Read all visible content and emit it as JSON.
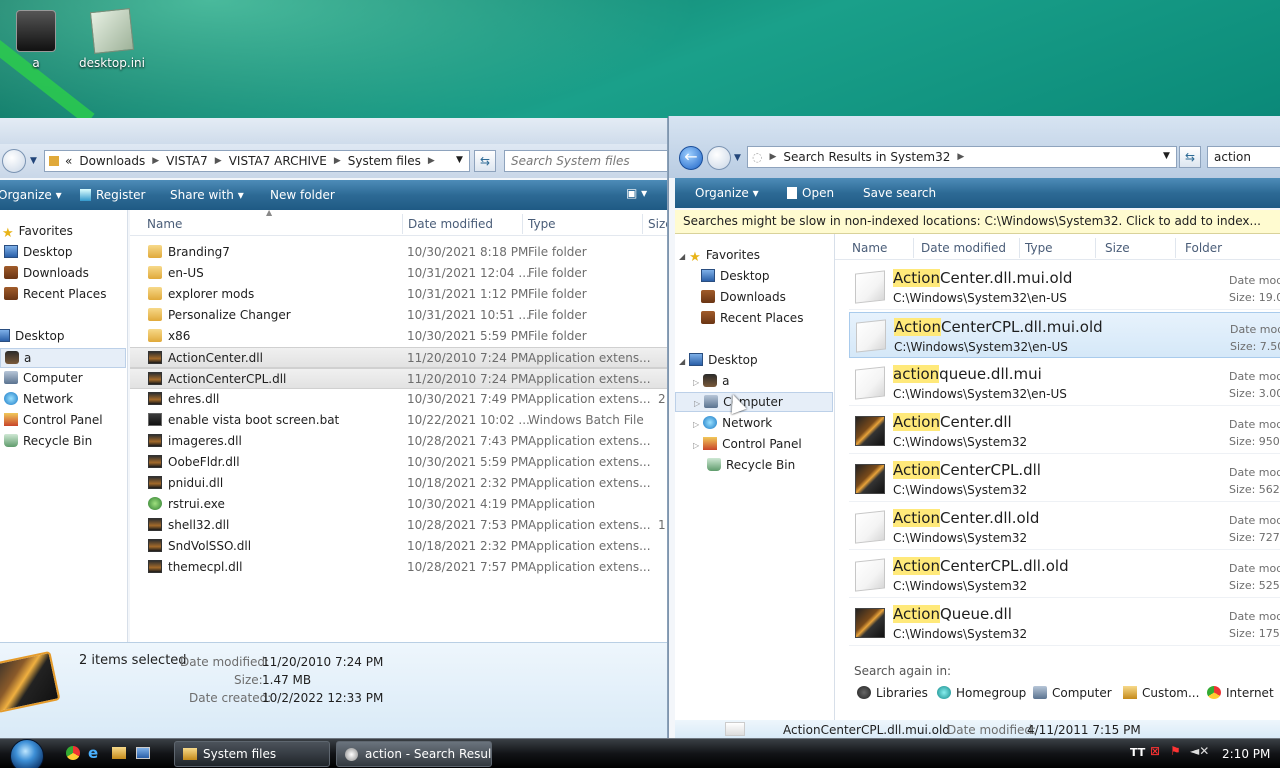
{
  "desktop": {
    "icons": [
      {
        "label": "a"
      },
      {
        "label": "desktop.ini"
      }
    ]
  },
  "win1": {
    "breadcrumb": [
      "«",
      "Downloads",
      "VISTA7",
      "VISTA7 ARCHIVE",
      "System files"
    ],
    "search_placeholder": "Search System files",
    "toolbar": {
      "organize": "Organize",
      "register": "Register",
      "share": "Share with",
      "newfolder": "New folder"
    },
    "nav": {
      "favorites": "Favorites",
      "desktop": "Desktop",
      "downloads": "Downloads",
      "recent": "Recent Places",
      "desktop2": "Desktop",
      "a": "a",
      "computer": "Computer",
      "network": "Network",
      "control": "Control Panel",
      "recycle": "Recycle Bin"
    },
    "columns": {
      "name": "Name",
      "date": "Date modified",
      "type": "Type",
      "size": "Size"
    },
    "files": [
      {
        "name": "Branding7",
        "date": "10/30/2021 8:18 PM",
        "type": "File folder",
        "icon": "folder"
      },
      {
        "name": "en-US",
        "date": "10/31/2021 12:04 ...",
        "type": "File folder",
        "icon": "folder"
      },
      {
        "name": "explorer mods",
        "date": "10/31/2021 1:12 PM",
        "type": "File folder",
        "icon": "folder"
      },
      {
        "name": "Personalize Changer",
        "date": "10/31/2021 10:51 ...",
        "type": "File folder",
        "icon": "folder"
      },
      {
        "name": "x86",
        "date": "10/30/2021 5:59 PM",
        "type": "File folder",
        "icon": "folder"
      },
      {
        "name": "ActionCenter.dll",
        "date": "11/20/2010 7:24 PM",
        "type": "Application extens...",
        "icon": "dll"
      },
      {
        "name": "ActionCenterCPL.dll",
        "date": "11/20/2010 7:24 PM",
        "type": "Application extens...",
        "icon": "dll"
      },
      {
        "name": "ehres.dll",
        "date": "10/30/2021 7:49 PM",
        "type": "Application extens...",
        "icon": "dll",
        "size": "2"
      },
      {
        "name": "enable vista boot screen.bat",
        "date": "10/22/2021 10:02 ...",
        "type": "Windows Batch File",
        "icon": "bat"
      },
      {
        "name": "imageres.dll",
        "date": "10/28/2021 7:43 PM",
        "type": "Application extens...",
        "icon": "dll"
      },
      {
        "name": "OobeFldr.dll",
        "date": "10/30/2021 5:59 PM",
        "type": "Application extens...",
        "icon": "dll"
      },
      {
        "name": "pnidui.dll",
        "date": "10/18/2021 2:32 PM",
        "type": "Application extens...",
        "icon": "dll"
      },
      {
        "name": "rstrui.exe",
        "date": "10/30/2021 4:19 PM",
        "type": "Application",
        "icon": "app"
      },
      {
        "name": "shell32.dll",
        "date": "10/28/2021 7:53 PM",
        "type": "Application extens...",
        "icon": "dll",
        "size": "1"
      },
      {
        "name": "SndVolSSO.dll",
        "date": "10/18/2021 2:32 PM",
        "type": "Application extens...",
        "icon": "dll"
      },
      {
        "name": "themecpl.dll",
        "date": "10/28/2021 7:57 PM",
        "type": "Application extens...",
        "icon": "dll"
      }
    ],
    "details": {
      "selected": "2 items selected",
      "modified_label": "Date modified:",
      "modified": "11/20/2010 7:24 PM",
      "size_label": "Size:",
      "size": "1.47 MB",
      "created_label": "Date created:",
      "created": "10/2/2022 12:33 PM"
    }
  },
  "win2": {
    "breadcrumb": "Search Results in System32",
    "search_value": "action",
    "toolbar": {
      "organize": "Organize",
      "open": "Open",
      "save": "Save search"
    },
    "infobar": "Searches might be slow in non-indexed locations: C:\\Windows\\System32. Click to add to index...",
    "nav": {
      "favorites": "Favorites",
      "desktop": "Desktop",
      "downloads": "Downloads",
      "recent": "Recent Places",
      "desktop2": "Desktop",
      "a": "a",
      "computer": "Computer",
      "network": "Network",
      "control": "Control Panel",
      "recycle": "Recycle Bin"
    },
    "columns": {
      "name": "Name",
      "date": "Date modified",
      "type": "Type",
      "size": "Size",
      "folder": "Folder"
    },
    "results": [
      {
        "hl": "Action",
        "rest": "Center.dll.mui.old",
        "path": "C:\\Windows\\System32\\en-US",
        "meta1": "Date mod",
        "meta2": "Size: 19.0",
        "thumb": "doc"
      },
      {
        "hl": "Action",
        "rest": "CenterCPL.dll.mui.old",
        "path": "C:\\Windows\\System32\\en-US",
        "meta1": "Date mod",
        "meta2": "Size: 7.50",
        "thumb": "doc"
      },
      {
        "hl": "action",
        "rest": "queue.dll.mui",
        "path": "C:\\Windows\\System32\\en-US",
        "meta1": "Date mod",
        "meta2": "Size: 3.00",
        "thumb": "doc"
      },
      {
        "hl": "Action",
        "rest": "Center.dll",
        "path": "C:\\Windows\\System32",
        "meta1": "Date mod",
        "meta2": "Size: 950 k",
        "thumb": "dllbig"
      },
      {
        "hl": "Action",
        "rest": "CenterCPL.dll",
        "path": "C:\\Windows\\System32",
        "meta1": "Date mod",
        "meta2": "Size: 562 k",
        "thumb": "dllbig"
      },
      {
        "hl": "Action",
        "rest": "Center.dll.old",
        "path": "C:\\Windows\\System32",
        "meta1": "Date mod",
        "meta2": "Size: 727 k",
        "thumb": "doc"
      },
      {
        "hl": "Action",
        "rest": "CenterCPL.dll.old",
        "path": "C:\\Windows\\System32",
        "meta1": "Date mod",
        "meta2": "Size: 525 k",
        "thumb": "doc"
      },
      {
        "hl": "Action",
        "rest": "Queue.dll",
        "path": "C:\\Windows\\System32",
        "meta1": "Date mod",
        "meta2": "Size: 175 k",
        "thumb": "dllbig"
      }
    ],
    "search_again": {
      "label": "Search again in:",
      "items": [
        "Libraries",
        "Homegroup",
        "Computer",
        "Custom...",
        "Internet"
      ]
    },
    "details": {
      "name": "ActionCenterCPL.dll.mui.old",
      "modified_label": "Date modified:",
      "modified": "4/11/2011 7:15 PM"
    }
  },
  "taskbar": {
    "tasks": [
      "System files",
      "action - Search Resul..."
    ],
    "time": "2:10 PM"
  }
}
